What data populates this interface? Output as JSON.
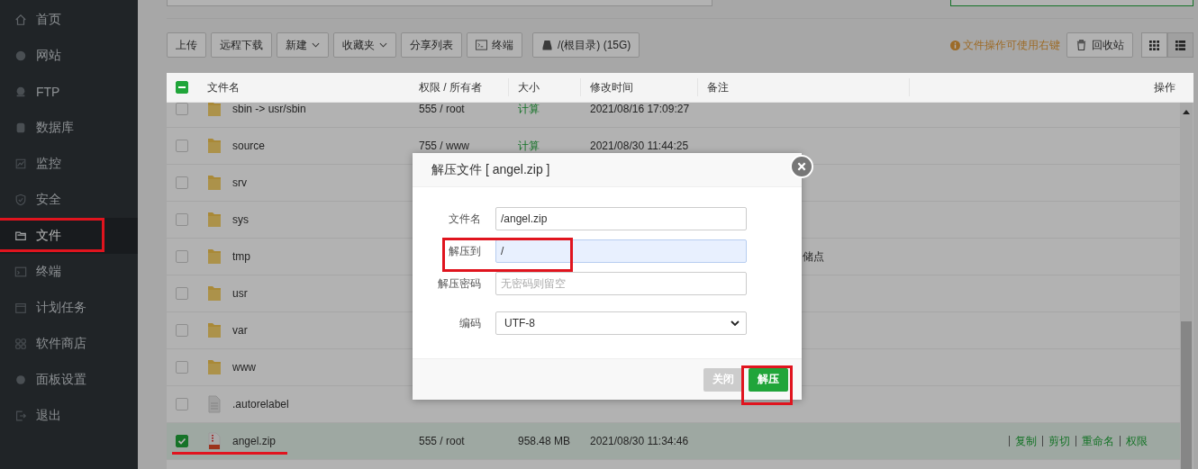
{
  "sidebar": {
    "items": [
      {
        "label": "首页",
        "selected": false
      },
      {
        "label": "网站",
        "selected": false
      },
      {
        "label": "FTP",
        "selected": false
      },
      {
        "label": "数据库",
        "selected": false
      },
      {
        "label": "监控",
        "selected": false
      },
      {
        "label": "安全",
        "selected": false
      },
      {
        "label": "文件",
        "selected": true
      },
      {
        "label": "终端",
        "selected": false
      },
      {
        "label": "计划任务",
        "selected": false
      },
      {
        "label": "软件商店",
        "selected": false
      },
      {
        "label": "面板设置",
        "selected": false
      },
      {
        "label": "退出",
        "selected": false
      }
    ]
  },
  "toolbar": {
    "buttons": [
      {
        "label": "上传",
        "kind": "plain"
      },
      {
        "label": "远程下载",
        "kind": "plain"
      },
      {
        "label": "新建",
        "kind": "dropdown"
      },
      {
        "label": "收藏夹",
        "kind": "dropdown"
      },
      {
        "label": "分享列表",
        "kind": "plain"
      },
      {
        "label": "终端",
        "kind": "terminal"
      },
      {
        "label": "/(根目录) (15G)",
        "kind": "disk"
      }
    ],
    "hint": "文件操作可使用右键",
    "recycle": "回收站",
    "views": [
      {
        "selected": false
      },
      {
        "selected": true
      }
    ]
  },
  "table": {
    "select_all": {
      "indeterminate": true
    },
    "columns": [
      "文件名",
      "权限 / 所有者",
      "大小",
      "修改时间",
      "备注",
      "操作"
    ],
    "rows": [
      {
        "name": "sbin -> usr/sbin",
        "kind": "folder",
        "checked": false,
        "perm": "555 / root",
        "size": "计算",
        "time": "2021/08/16 17:09:27"
      },
      {
        "name": "source",
        "kind": "folder",
        "checked": false,
        "perm": "755 / www",
        "size": "计算",
        "time": "2021/08/30 11:44:25"
      },
      {
        "name": "srv",
        "kind": "folder",
        "checked": false
      },
      {
        "name": "sys",
        "kind": "folder",
        "checked": false
      },
      {
        "name": "tmp",
        "kind": "folder",
        "checked": false,
        "remark": "储点"
      },
      {
        "name": "usr",
        "kind": "folder",
        "checked": false
      },
      {
        "name": "var",
        "kind": "folder",
        "checked": false
      },
      {
        "name": "www",
        "kind": "folder",
        "checked": false
      },
      {
        "name": ".autorelabel",
        "kind": "file",
        "checked": false
      },
      {
        "name": "angel.zip",
        "kind": "zip",
        "checked": true,
        "perm": "555 / root",
        "size": "958.48 MB",
        "time": "2021/08/30 11:34:46",
        "actions": [
          "复制",
          "剪切",
          "重命名",
          "权限"
        ]
      }
    ]
  },
  "dialog": {
    "title": "解压文件 [ angel.zip ]",
    "fields": [
      {
        "label": "文件名",
        "kind": "text",
        "value": "/angel.zip",
        "focused": false
      },
      {
        "label": "解压到",
        "kind": "text",
        "value": "/",
        "focused": true
      },
      {
        "label": "解压密码",
        "kind": "text",
        "placeholder": "无密码则留空",
        "focused": false
      },
      {
        "label": "编码",
        "kind": "select",
        "value": "UTF-8",
        "focused": false
      }
    ],
    "buttons": [
      {
        "label": "关闭",
        "kind": "secondary"
      },
      {
        "label": "解压",
        "kind": "primary"
      }
    ]
  }
}
